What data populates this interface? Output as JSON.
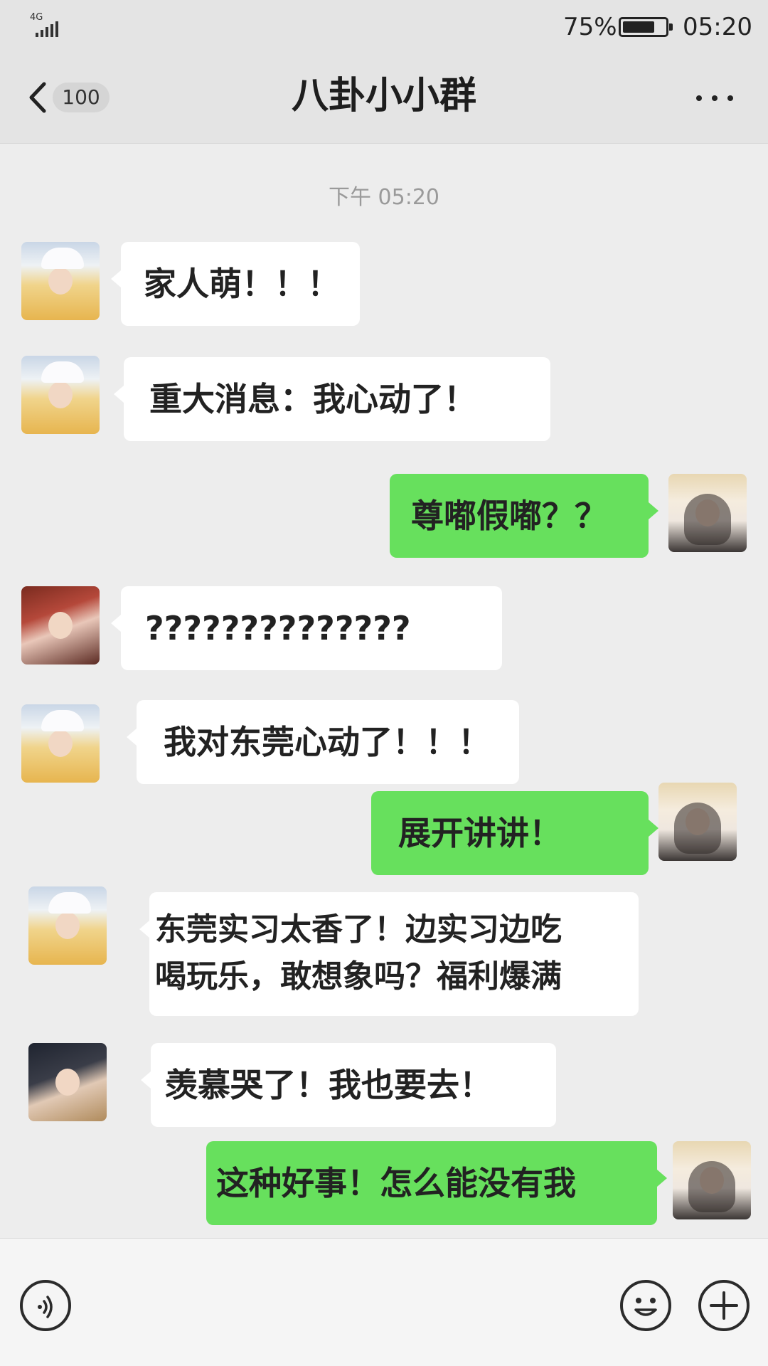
{
  "status_bar": {
    "network": "4G",
    "battery_percent": "75%",
    "battery_level": 0.75,
    "time": "05:20"
  },
  "header": {
    "back_icon": "chevron-left-icon",
    "unread_count": "100",
    "title": "八卦小小群",
    "more_icon": "more-dots-icon"
  },
  "chat": {
    "timestamp": "下午 05:20",
    "messages": [
      {
        "direction": "incoming",
        "avatar": "girl-white-hat",
        "lines": [
          "家人萌！！！"
        ]
      },
      {
        "direction": "incoming",
        "avatar": "girl-white-hat",
        "lines": [
          "重大消息：我心动了！"
        ]
      },
      {
        "direction": "outgoing",
        "avatar": "girl-braids-straw-hat",
        "lines": [
          "尊嘟假嘟？？"
        ]
      },
      {
        "direction": "incoming",
        "avatar": "girl-red-dress",
        "lines": [
          "??????????????"
        ]
      },
      {
        "direction": "incoming",
        "avatar": "girl-white-hat",
        "lines": [
          "我对东莞心动了！！！"
        ]
      },
      {
        "direction": "outgoing",
        "avatar": "girl-braids-straw-hat",
        "lines": [
          "展开讲讲！"
        ]
      },
      {
        "direction": "incoming",
        "avatar": "girl-white-hat",
        "lines": [
          "东莞实习太香了！边实习边吃",
          "喝玩乐，敢想象吗？福利爆满"
        ]
      },
      {
        "direction": "incoming",
        "avatar": "girl-dark-hair",
        "lines": [
          "羡慕哭了！我也要去！"
        ]
      },
      {
        "direction": "outgoing",
        "avatar": "girl-braids-straw-hat",
        "lines": [
          "这种好事！怎么能没有我"
        ]
      }
    ]
  },
  "input_bar": {
    "voice_icon": "voice-icon",
    "emoji_icon": "emoji-icon",
    "plus_icon": "plus-icon"
  },
  "colors": {
    "outgoing_bubble": "#67e05d",
    "incoming_bubble": "#ffffff",
    "background": "#ededed"
  }
}
